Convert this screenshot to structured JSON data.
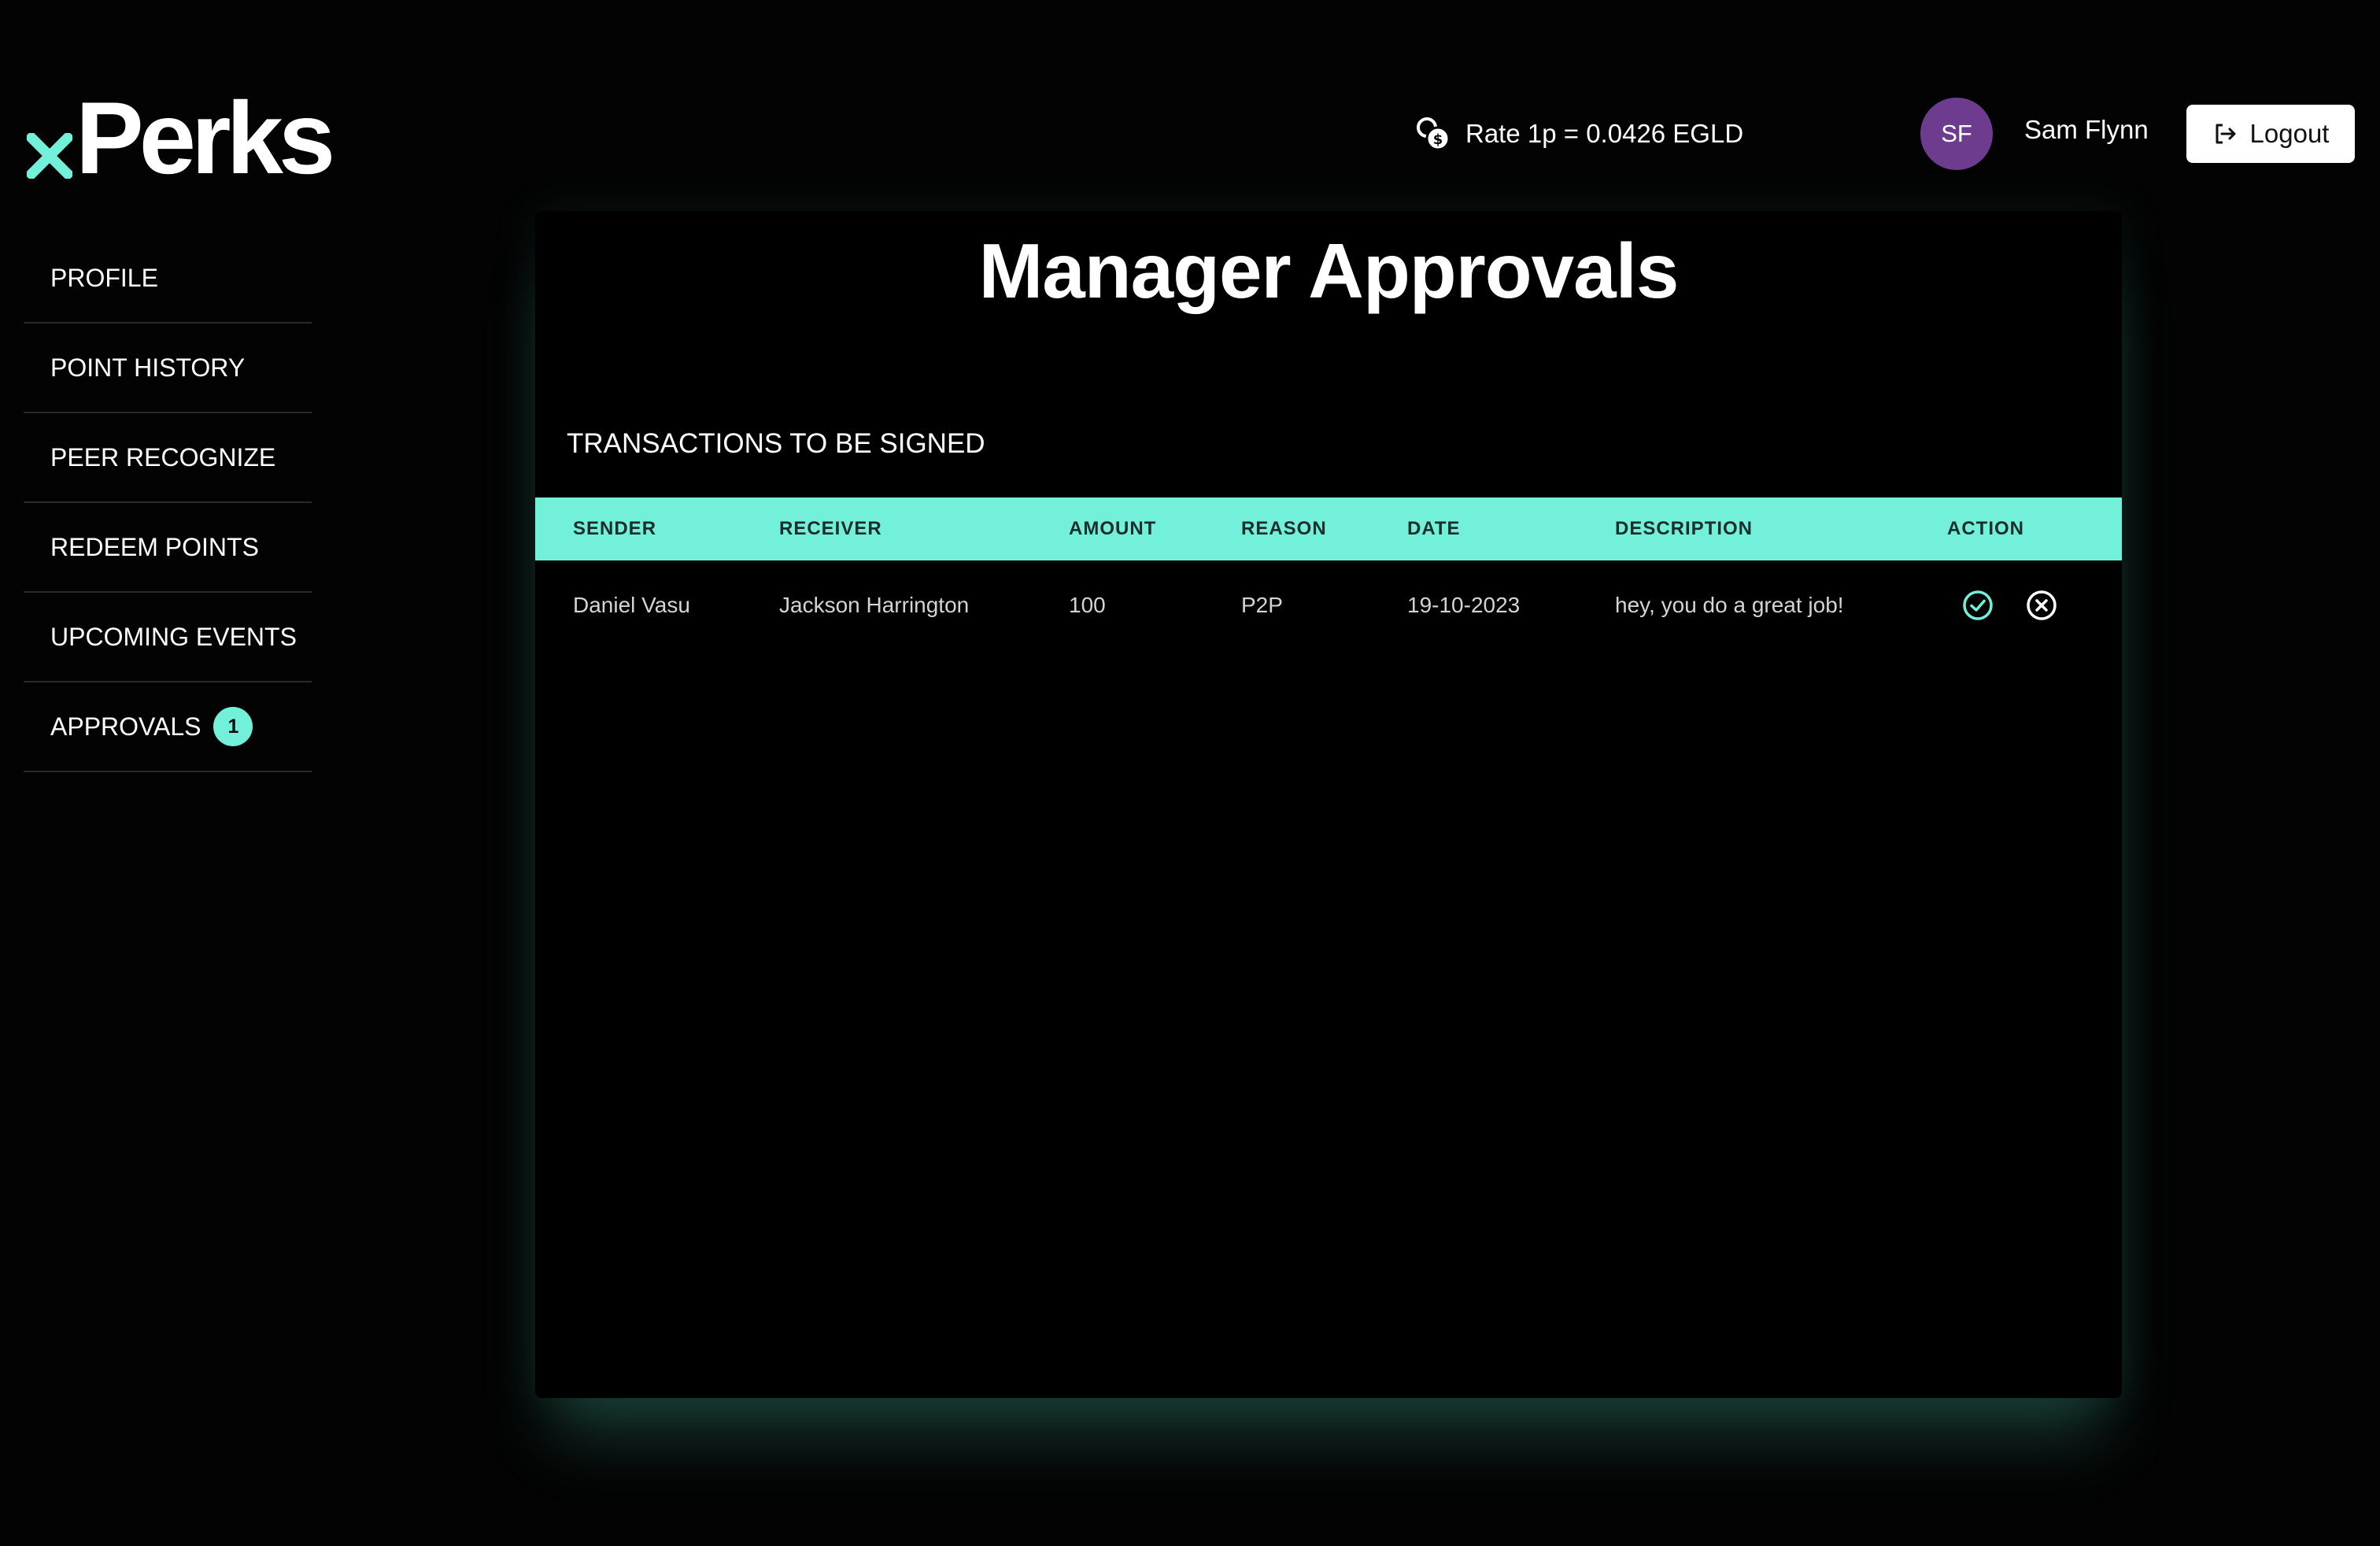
{
  "brand": {
    "logo_mark": "x",
    "logo_text": "Perks",
    "accent_color": "#72f0da"
  },
  "header": {
    "rate_icon": "coins-icon",
    "rate_text": "Rate 1p = 0.0426 EGLD",
    "user": {
      "initials": "SF",
      "name": "Sam Flynn",
      "avatar_color": "#6d3c8e"
    },
    "logout_icon": "logout-icon",
    "logout_label": "Logout"
  },
  "sidebar": {
    "items": [
      {
        "label": "PROFILE"
      },
      {
        "label": "POINT HISTORY"
      },
      {
        "label": "PEER RECOGNIZE"
      },
      {
        "label": "REDEEM POINTS"
      },
      {
        "label": "UPCOMING EVENTS"
      },
      {
        "label": "APPROVALS",
        "badge": "1"
      }
    ]
  },
  "main": {
    "title": "Manager Approvals",
    "section_title": "TRANSACTIONS TO BE SIGNED",
    "table": {
      "columns": [
        "SENDER",
        "RECEIVER",
        "AMOUNT",
        "REASON",
        "DATE",
        "DESCRIPTION",
        "ACTION"
      ],
      "rows": [
        {
          "sender": "Daniel Vasu",
          "receiver": "Jackson Harrington",
          "amount": "100",
          "reason": "P2P",
          "date": "19-10-2023",
          "description": "hey, you do a great job!",
          "actions": [
            "check-circle-icon",
            "x-circle-icon"
          ]
        }
      ]
    }
  }
}
